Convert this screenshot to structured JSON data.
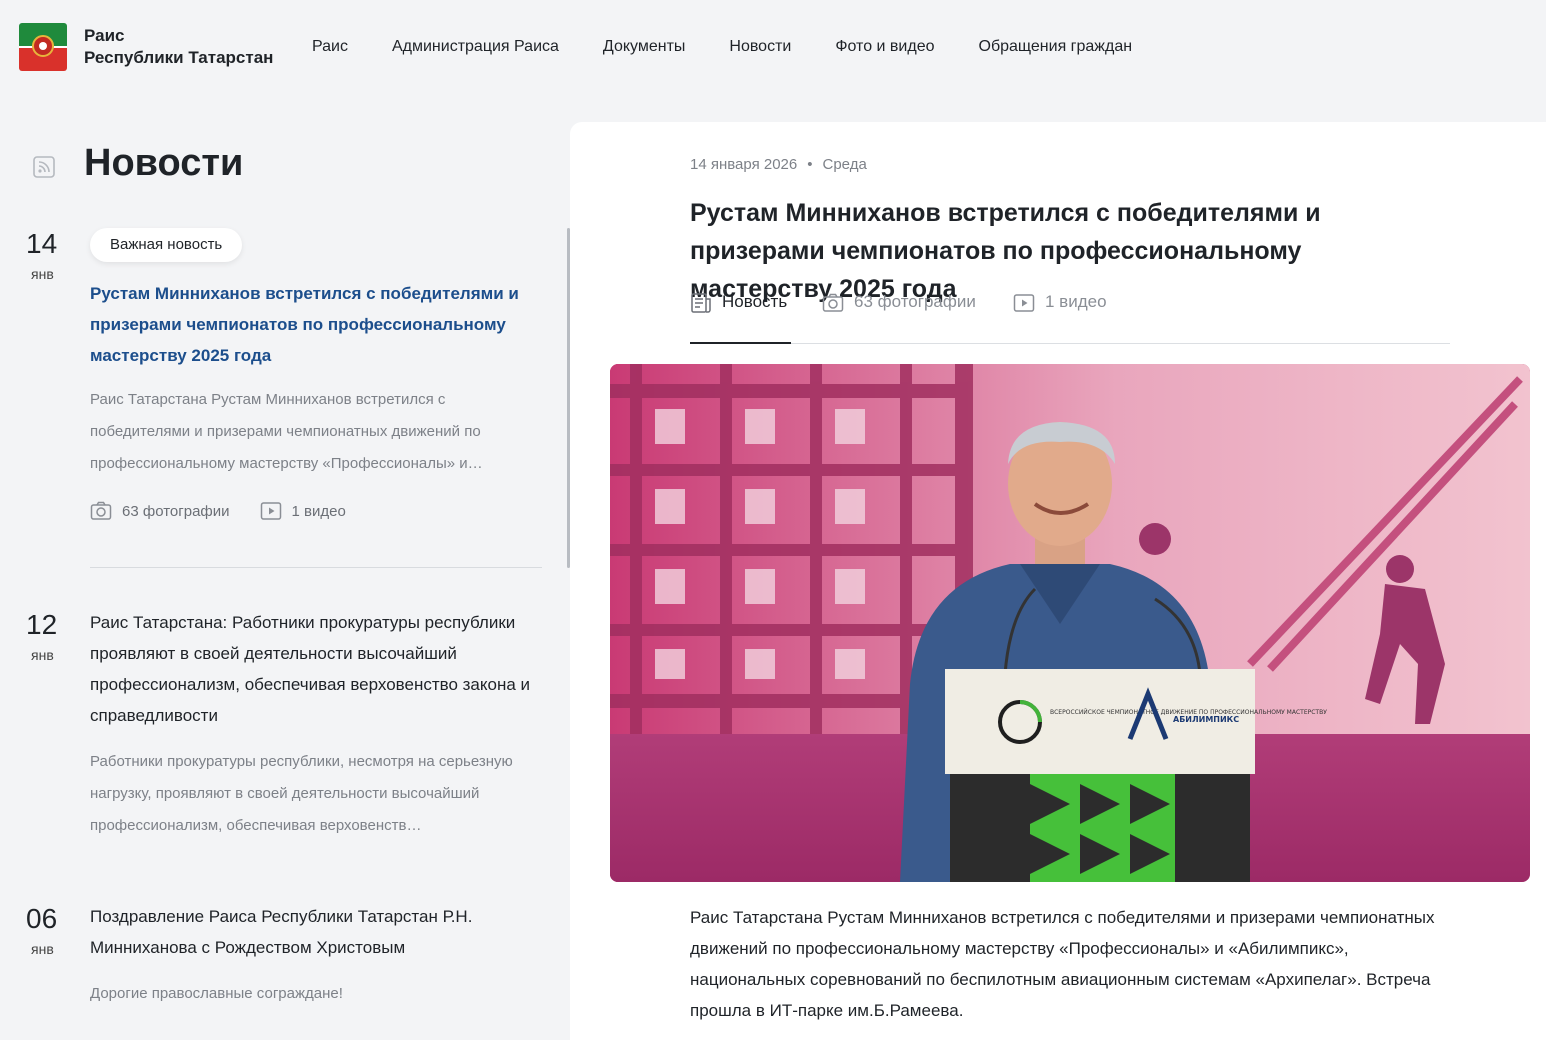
{
  "header": {
    "title_line1": "Раис",
    "title_line2": "Республики Татарстан",
    "nav": [
      "Раис",
      "Администрация Раиса",
      "Документы",
      "Новости",
      "Фото и видео",
      "Обращения граждан"
    ]
  },
  "sidebar": {
    "heading": "Новости",
    "items": [
      {
        "day": "14",
        "month": "янв",
        "badge": "Важная новость",
        "title": "Рустам Минниханов встретился с победителями и призерами чемпионатов по профессиональному мастерству 2025 года",
        "lead": "Раис Татарстана Рустам Минниханов встретился с победителями и призерами чемпионатных движений по профессиональному мастерству «Профессионалы» и…",
        "photos": "63 фотографии",
        "videos": "1 видео"
      },
      {
        "day": "12",
        "month": "янв",
        "title": "Раис Татарстана: Работники прокуратуры республики проявляют в своей деятельности высочайший профессионализм, обеспечивая верховенство закона и справедливости",
        "lead": "Работники прокуратуры республики, несмотря на серьезную нагрузку, проявляют в своей деятельности высочайший профессионализм, обеспечивая верховенств…"
      },
      {
        "day": "06",
        "month": "янв",
        "title": "Поздравление Раиса Республики Татарстан Р.Н. Минниханова с Рождеством Христовым",
        "lead": "Дорогие православные сограждане!"
      }
    ]
  },
  "article": {
    "date": "14 января 2026",
    "weekday": "Среда",
    "title": "Рустам Минниханов встретился с победителями и призерами чемпионатов по профессиональному мастерству 2025 года",
    "tabs": [
      "Новость",
      "63 фотографии",
      "1 видео"
    ],
    "podium_logo_left": "ВСЕРОССИЙСКОЕ ЧЕМПИОНАТНОЕ ДВИЖЕНИЕ ПО ПРОФЕССИОНАЛЬНОМУ МАСТЕРСТВУ",
    "podium_logo_right": "АБИЛИМПИКС",
    "body": "Раис Татарстана Рустам Минниханов встретился с победителями и призерами чемпионатных движений по профессиональному мастерству «Профессионалы» и «Абилимпикс», национальных соревнований по беспилотным авиационным системам «Архипелаг». Встреча прошла в ИТ-парке им.Б.Рамеева."
  },
  "colors": {
    "active_link": "#1c4e8c",
    "photo_bg": "#b8336a",
    "flag_green": "#1f8a3c",
    "flag_red": "#d9312b"
  }
}
